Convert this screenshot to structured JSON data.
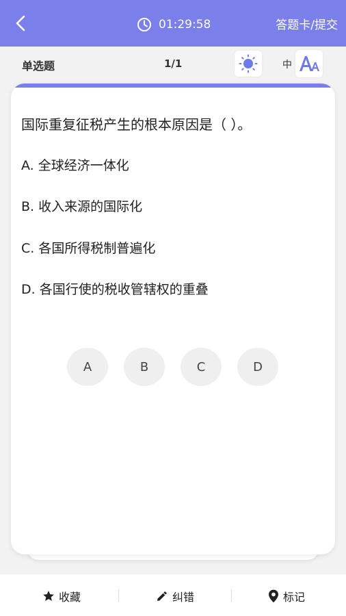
{
  "header": {
    "back_icon": "chevron-left-icon",
    "timer_icon": "clock-icon",
    "timer": "01:29:58",
    "submit_label": "答题卡/提交",
    "bg_color": "#7b7fe9"
  },
  "subbar": {
    "question_type": "单选题",
    "counter": "1/1",
    "theme_icon": "sun-icon",
    "font_size_label": "中",
    "font_icon": "font-size-icon"
  },
  "question": {
    "text": "国际重复征税产生的根本原因是（   ）。",
    "options": [
      "A. 全球经济一体化",
      "B. 收入来源的国际化",
      "C. 各国所得税制普遍化",
      "D. 各国行使的税收管辖权的重叠"
    ]
  },
  "answer_buttons": [
    "A",
    "B",
    "C",
    "D"
  ],
  "footer": {
    "favorite_label": "收藏",
    "favorite_icon": "star-icon",
    "report_label": "纠错",
    "report_icon": "pencil-icon",
    "mark_label": "标记",
    "mark_icon": "location-pin-icon"
  }
}
